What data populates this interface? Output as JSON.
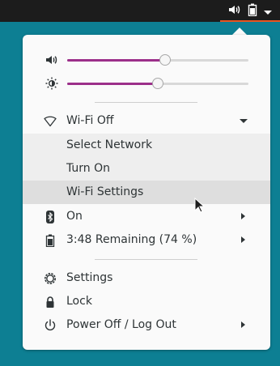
{
  "topbar": {
    "icons": [
      "volume-icon",
      "battery-icon",
      "dropdown-icon"
    ]
  },
  "menu": {
    "volume": {
      "icon": "audio-volume-icon",
      "level": 0.54
    },
    "brightness": {
      "icon": "brightness-icon",
      "level": 0.5
    },
    "wifi": {
      "icon": "wifi-icon",
      "label": "Wi-Fi Off",
      "submenu": [
        "Select Network",
        "Turn On",
        "Wi-Fi Settings"
      ]
    },
    "bluetooth": {
      "icon": "bluetooth-icon",
      "label": "On"
    },
    "battery": {
      "icon": "battery-icon",
      "label": "3:48 Remaining (74 %)"
    },
    "settings": {
      "icon": "settings-icon",
      "label": "Settings"
    },
    "lock": {
      "icon": "lock-icon",
      "label": "Lock"
    },
    "power": {
      "icon": "power-icon",
      "label": "Power Off / Log Out"
    }
  },
  "colors": {
    "desktop": "#0d7f93",
    "accent": "#9c2f8a",
    "topbar_underline": "#e95420"
  }
}
